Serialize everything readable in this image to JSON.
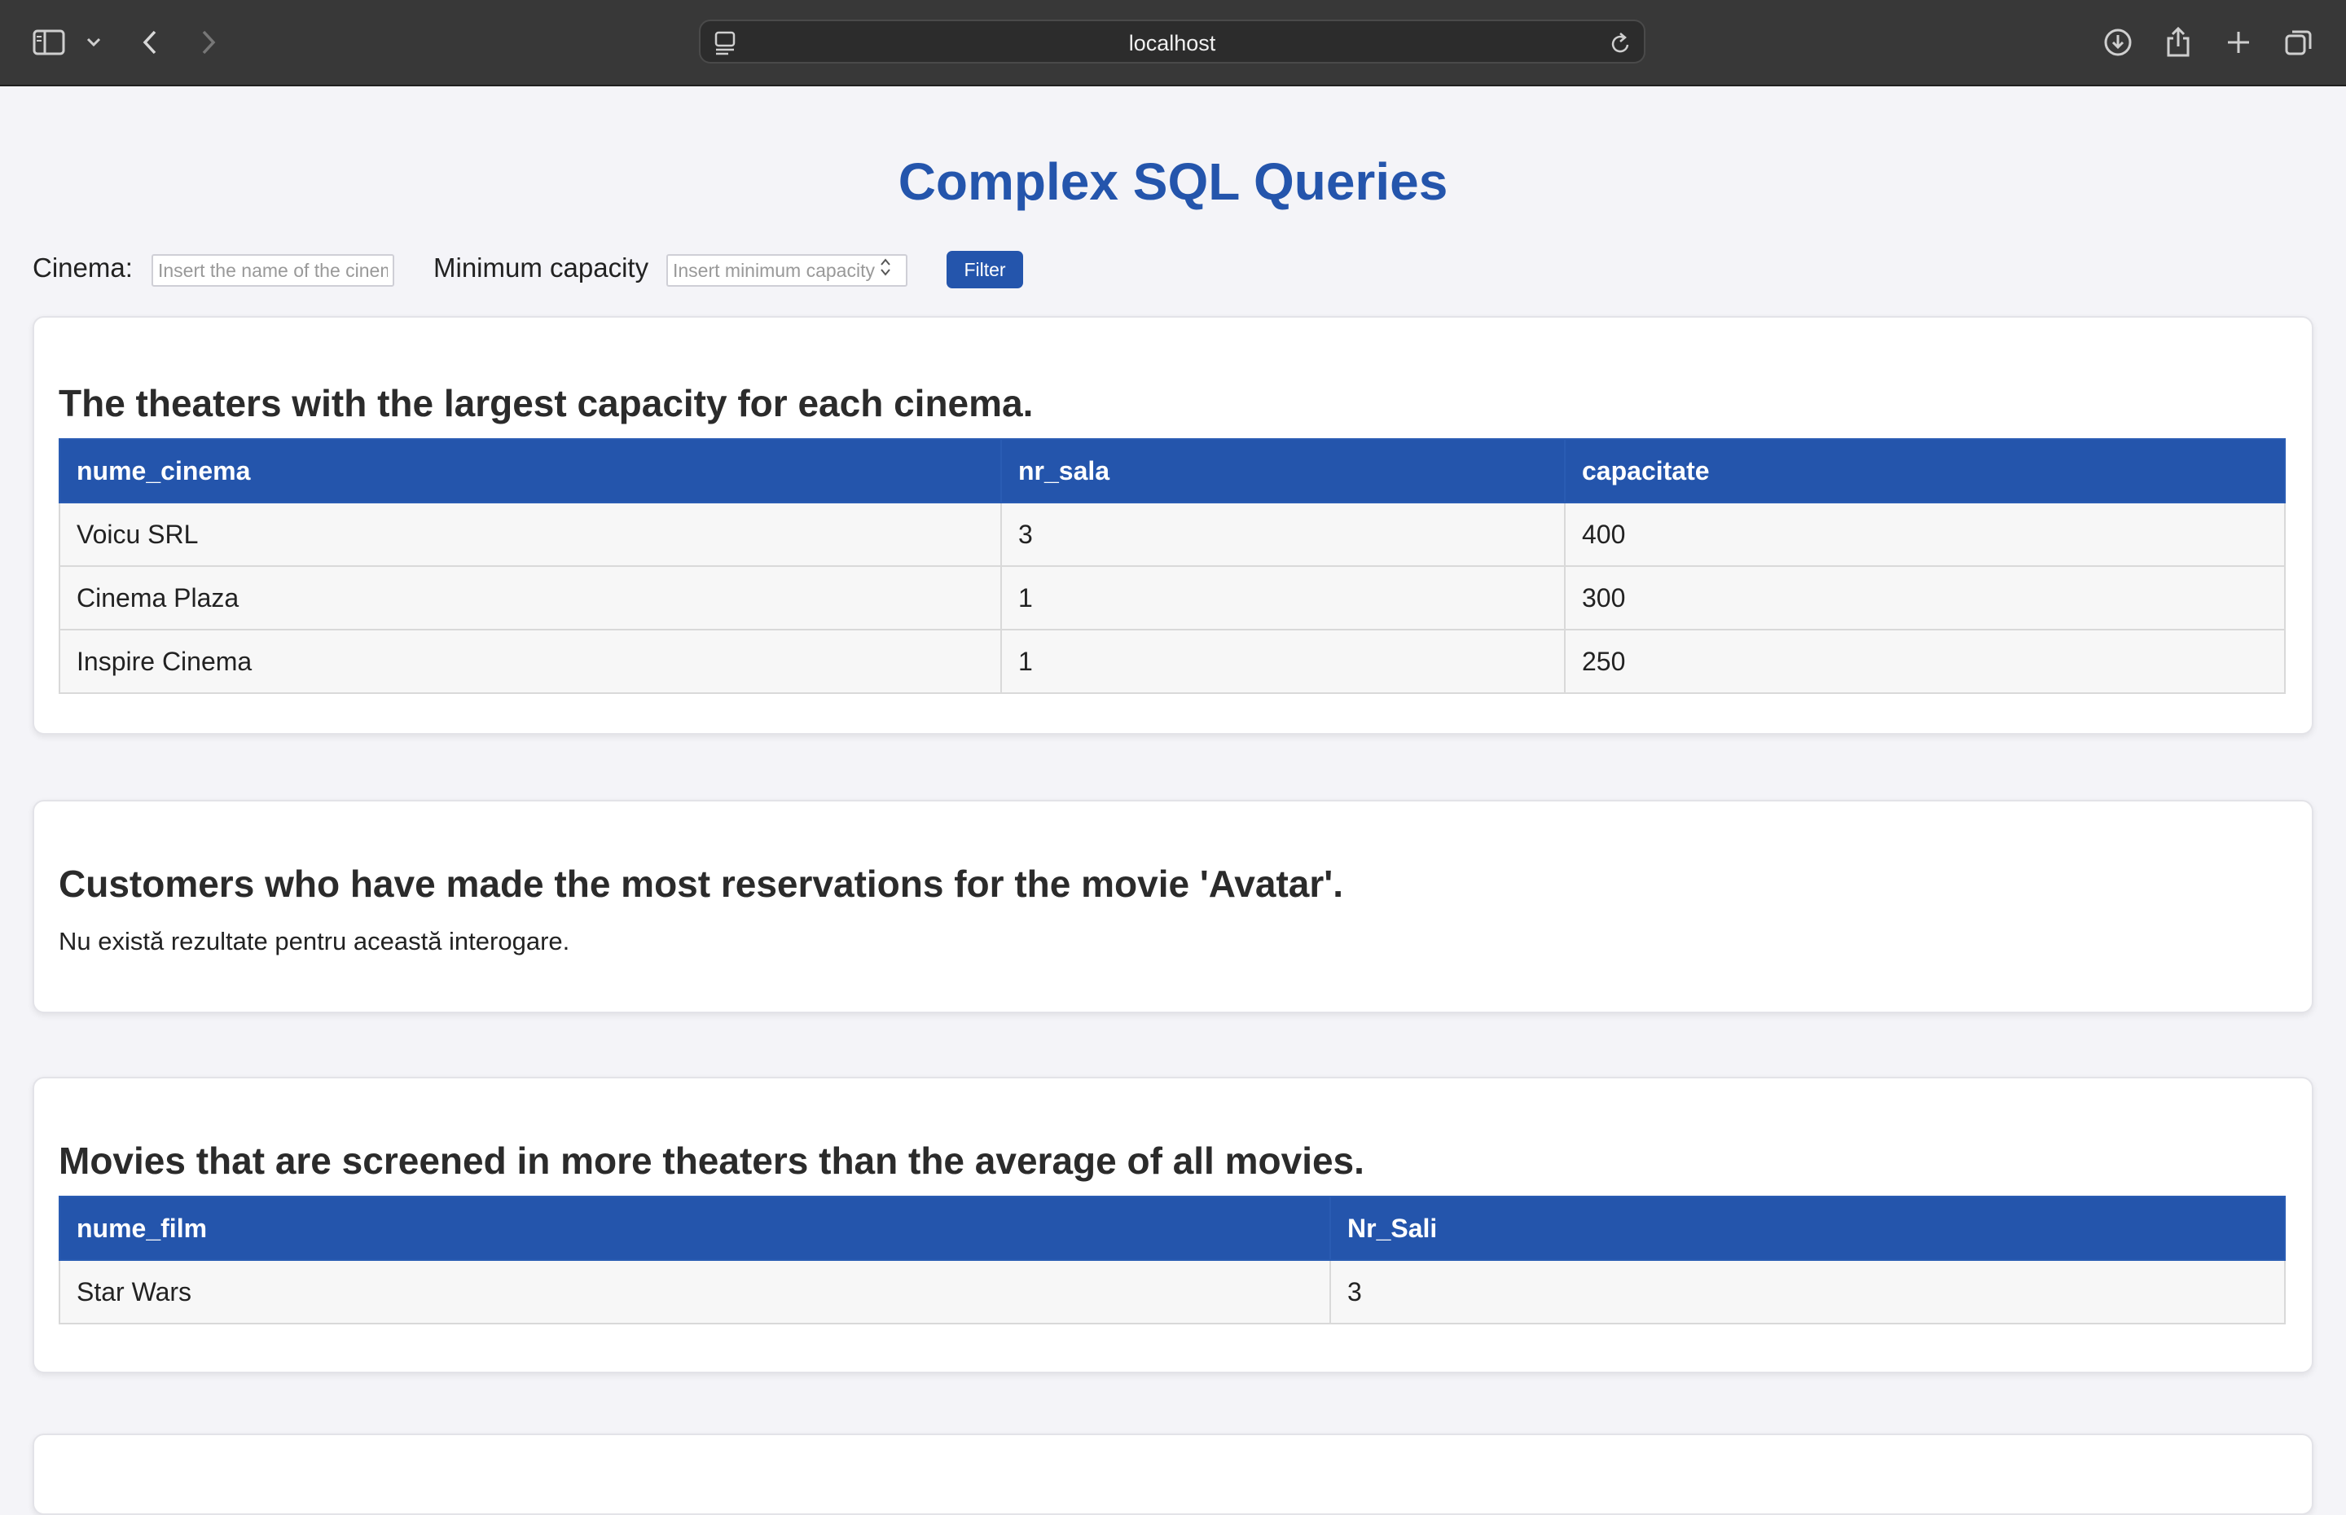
{
  "browser": {
    "url": "localhost",
    "icons": {
      "sidebar": "sidebar-icon",
      "chevron": "chevron-down-icon",
      "back": "back-icon",
      "forward": "forward-icon",
      "download": "download-icon",
      "share": "share-icon",
      "new_tab": "plus-icon",
      "tabs": "tabs-overview-icon"
    }
  },
  "page": {
    "title": "Complex SQL Queries",
    "filters": {
      "cinema_label": "Cinema:",
      "cinema_placeholder": "Insert the name of the cinema",
      "capacity_label": "Minimum capacity",
      "capacity_placeholder": "Insert minimum capacity",
      "filter_button": "Filter"
    },
    "sections": [
      {
        "heading": "The theaters with the largest capacity for each cinema.",
        "columns": [
          "nume_cinema",
          "nr_sala",
          "capacitate"
        ],
        "rows": [
          [
            "Voicu SRL",
            "3",
            "400"
          ],
          [
            "Cinema Plaza",
            "1",
            "300"
          ],
          [
            "Inspire Cinema",
            "1",
            "250"
          ]
        ]
      },
      {
        "heading": "Customers who have made the most reservations for the movie 'Avatar'.",
        "empty_message": "Nu există rezultate pentru această interogare."
      },
      {
        "heading": "Movies that are screened in more theaters than the average of all movies.",
        "columns": [
          "nume_film",
          "Nr_Sali"
        ],
        "rows": [
          [
            "Star Wars",
            "3"
          ]
        ]
      }
    ]
  },
  "colors": {
    "accent": "#2455ac",
    "toolbar": "#383838",
    "background": "#f4f4f8"
  }
}
